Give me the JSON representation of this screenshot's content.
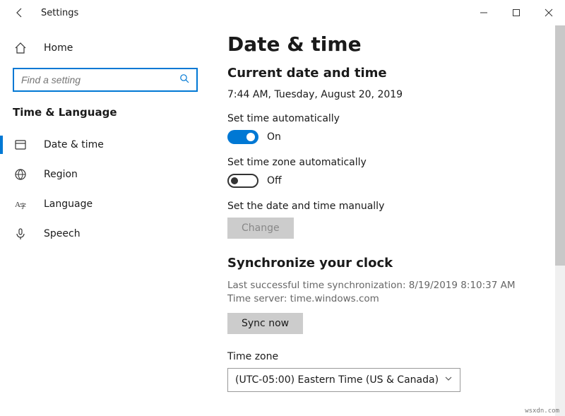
{
  "window": {
    "title": "Settings"
  },
  "sidebar": {
    "home_label": "Home",
    "search_placeholder": "Find a setting",
    "group_title": "Time & Language",
    "items": [
      {
        "label": "Date & time",
        "selected": true
      },
      {
        "label": "Region",
        "selected": false
      },
      {
        "label": "Language",
        "selected": false
      },
      {
        "label": "Speech",
        "selected": false
      }
    ]
  },
  "main": {
    "page_title": "Date & time",
    "current_heading": "Current date and time",
    "current_value": "7:44 AM, Tuesday, August 20, 2019",
    "auto_time_label": "Set time automatically",
    "auto_time_state": "On",
    "auto_tz_label": "Set time zone automatically",
    "auto_tz_state": "Off",
    "manual_label": "Set the date and time manually",
    "change_btn": "Change",
    "sync_heading": "Synchronize your clock",
    "sync_last": "Last successful time synchronization: 8/19/2019 8:10:37 AM",
    "sync_server": "Time server: time.windows.com",
    "sync_btn": "Sync now",
    "tz_label": "Time zone",
    "tz_value": "(UTC-05:00) Eastern Time (US & Canada)"
  },
  "footer": "wsxdn.com"
}
